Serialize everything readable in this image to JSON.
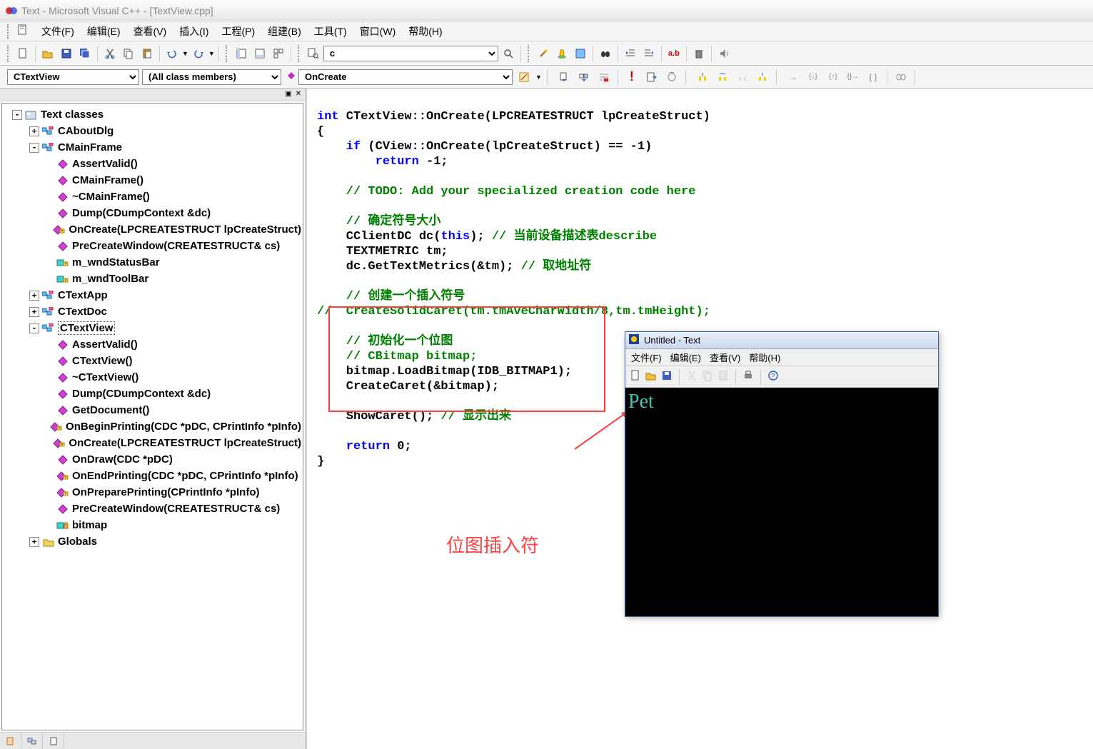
{
  "title": "Text - Microsoft Visual C++ - [TextView.cpp]",
  "menu": [
    "文件(F)",
    "编辑(E)",
    "查看(V)",
    "插入(I)",
    "工程(P)",
    "组建(B)",
    "工具(T)",
    "窗口(W)",
    "帮助(H)"
  ],
  "searchCombo": "c",
  "wizardBar": {
    "classCombo": "CTextView",
    "filterCombo": "(All class members)",
    "memberCombo": "OnCreate"
  },
  "tree": [
    {
      "d": 0,
      "exp": "-",
      "icon": "proj",
      "label": "Text classes"
    },
    {
      "d": 1,
      "exp": "+",
      "icon": "class",
      "label": "CAboutDlg"
    },
    {
      "d": 1,
      "exp": "-",
      "icon": "class",
      "label": "CMainFrame"
    },
    {
      "d": 2,
      "exp": "",
      "icon": "func-pub",
      "label": "AssertValid()"
    },
    {
      "d": 2,
      "exp": "",
      "icon": "func-pub",
      "label": "CMainFrame()"
    },
    {
      "d": 2,
      "exp": "",
      "icon": "func-pub",
      "label": "~CMainFrame()"
    },
    {
      "d": 2,
      "exp": "",
      "icon": "func-pub",
      "label": "Dump(CDumpContext &dc)"
    },
    {
      "d": 2,
      "exp": "",
      "icon": "func-prot",
      "label": "OnCreate(LPCREATESTRUCT lpCreateStruct)"
    },
    {
      "d": 2,
      "exp": "",
      "icon": "func-pub",
      "label": "PreCreateWindow(CREATESTRUCT& cs)"
    },
    {
      "d": 2,
      "exp": "",
      "icon": "var-prot",
      "label": "m_wndStatusBar"
    },
    {
      "d": 2,
      "exp": "",
      "icon": "var-prot",
      "label": "m_wndToolBar"
    },
    {
      "d": 1,
      "exp": "+",
      "icon": "class",
      "label": "CTextApp"
    },
    {
      "d": 1,
      "exp": "+",
      "icon": "class",
      "label": "CTextDoc"
    },
    {
      "d": 1,
      "exp": "-",
      "icon": "class",
      "label": "CTextView",
      "selected": true
    },
    {
      "d": 2,
      "exp": "",
      "icon": "func-pub",
      "label": "AssertValid()"
    },
    {
      "d": 2,
      "exp": "",
      "icon": "func-pub",
      "label": "CTextView()"
    },
    {
      "d": 2,
      "exp": "",
      "icon": "func-pub",
      "label": "~CTextView()"
    },
    {
      "d": 2,
      "exp": "",
      "icon": "func-pub",
      "label": "Dump(CDumpContext &dc)"
    },
    {
      "d": 2,
      "exp": "",
      "icon": "func-pub",
      "label": "GetDocument()"
    },
    {
      "d": 2,
      "exp": "",
      "icon": "func-prot",
      "label": "OnBeginPrinting(CDC *pDC, CPrintInfo *pInfo)"
    },
    {
      "d": 2,
      "exp": "",
      "icon": "func-prot",
      "label": "OnCreate(LPCREATESTRUCT lpCreateStruct)"
    },
    {
      "d": 2,
      "exp": "",
      "icon": "func-pub",
      "label": "OnDraw(CDC *pDC)"
    },
    {
      "d": 2,
      "exp": "",
      "icon": "func-prot",
      "label": "OnEndPrinting(CDC *pDC, CPrintInfo *pInfo)"
    },
    {
      "d": 2,
      "exp": "",
      "icon": "func-prot",
      "label": "OnPreparePrinting(CPrintInfo *pInfo)"
    },
    {
      "d": 2,
      "exp": "",
      "icon": "func-pub",
      "label": "PreCreateWindow(CREATESTRUCT& cs)"
    },
    {
      "d": 2,
      "exp": "",
      "icon": "var-priv",
      "label": "bitmap"
    },
    {
      "d": 1,
      "exp": "+",
      "icon": "folder",
      "label": "Globals"
    }
  ],
  "code": {
    "l01a": "int",
    "l01b": " CTextView::OnCreate(LPCREATESTRUCT lpCreateStruct)",
    "l02": "{",
    "l03a": "    if",
    "l03b": " (CView::OnCreate(lpCreateStruct) == -1)",
    "l04a": "        return",
    "l04b": " -1;",
    "l05": "",
    "l06": "    // TODO: Add your specialized creation code here",
    "l07": "",
    "l08": "    // 确定符号大小",
    "l09a": "    CClientDC dc(",
    "l09b": "this",
    "l09c": "); ",
    "l09d": "// 当前设备描述表describe",
    "l10": "    TEXTMETRIC tm;",
    "l11a": "    dc.GetTextMetrics(&tm); ",
    "l11b": "// 取地址符",
    "l12": "",
    "l13": "    // 创建一个插入符号",
    "l14": "//  CreateSolidCaret(tm.tmAveCharWidth/8,tm.tmHeight);",
    "l15": "",
    "l16": "    // 初始化一个位图",
    "l17": "    // CBitmap bitmap;",
    "l18": "    bitmap.LoadBitmap(IDB_BITMAP1);",
    "l19": "    CreateCaret(&bitmap);",
    "l20": "",
    "l21a": "    ShowCaret(); ",
    "l21b": "// 显示出来",
    "l22": "",
    "l23a": "    return",
    "l23b": " 0;",
    "l24": "}"
  },
  "annotation": "位图插入符",
  "subApp": {
    "title": "Untitled - Text",
    "menu": [
      "文件(F)",
      "编辑(E)",
      "查看(V)",
      "帮助(H)"
    ],
    "canvasText": "Pet"
  }
}
